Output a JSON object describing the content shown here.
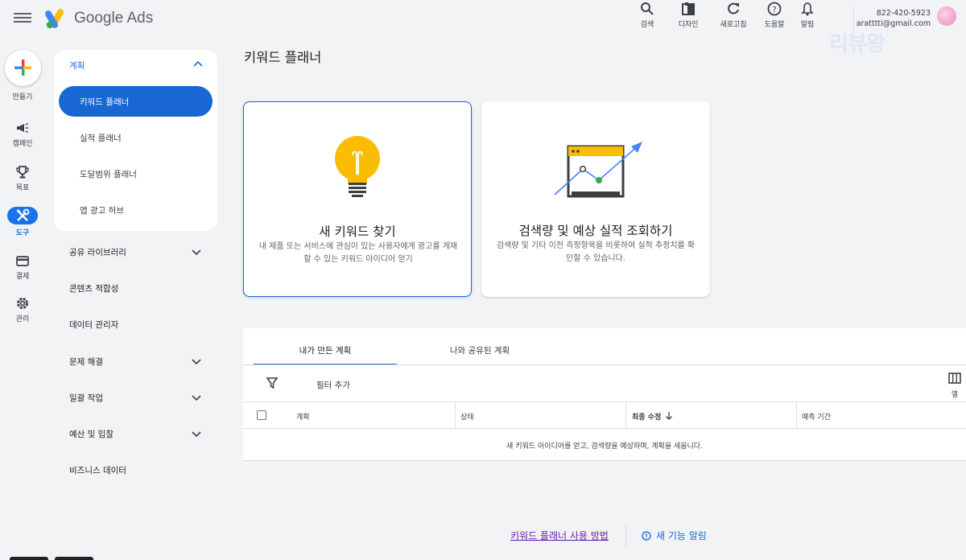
{
  "header": {
    "brand": "Google Ads",
    "tools": [
      "검색",
      "디자인",
      "새로고침",
      "도움말",
      "알림"
    ],
    "account_phone": "822-420-5923",
    "account_email": "aratttti@gmail.com",
    "watermark": "리뷰왕"
  },
  "rail": {
    "items": [
      "만들기",
      "캠페인",
      "목표",
      "도구",
      "결제",
      "관리"
    ],
    "active": "도구"
  },
  "nav": {
    "section_title": "계획",
    "sub_items": [
      "키워드 플래너",
      "실적 플래너",
      "도달범위 플래너",
      "앱 광고 허브"
    ],
    "active_sub": "키워드 플래너",
    "items": [
      "공유 라이브러리",
      "콘텐츠 적합성",
      "데이터 관리자",
      "문제 해결",
      "일괄 작업",
      "예산 및 입찰",
      "비즈니스 데이터"
    ]
  },
  "main": {
    "page_title": "키워드 플래너",
    "cards": [
      {
        "title": "새 키워드 찾기",
        "desc": "내 제품 또는 서비스에 관심이 있는 사용자에게 광고를 게재할 수 있는 키워드 아이디어 얻기",
        "icon": "lightbulb-icon"
      },
      {
        "title": "검색량 및 예상 실적 조회하기",
        "desc": "검색량 및 기타 이전 측정항목을 비롯하여 실적 추정치를 확인할 수 있습니다.",
        "icon": "trend-chart-icon"
      }
    ],
    "tabs": [
      "내가 만든 계획",
      "나와 공유된 계획"
    ],
    "active_tab": "내가 만든 계획",
    "filter_label": "필터 추가",
    "columns_label": "열",
    "table_headers": [
      "계획",
      "상태",
      "최종 수정",
      "예측 기간"
    ],
    "empty_text": "새 키워드 아이디어를 얻고, 검색량을 예상하며, 계획을 세웁니다."
  },
  "footer": {
    "how_to_link": "키워드 플래너 사용 방법",
    "whats_new": "새 기능 알림"
  },
  "colors": {
    "accent": "#1a73e8",
    "active_nav": "#1967d2",
    "bulb": "#fbbc04",
    "link_visited": "#681da8"
  }
}
